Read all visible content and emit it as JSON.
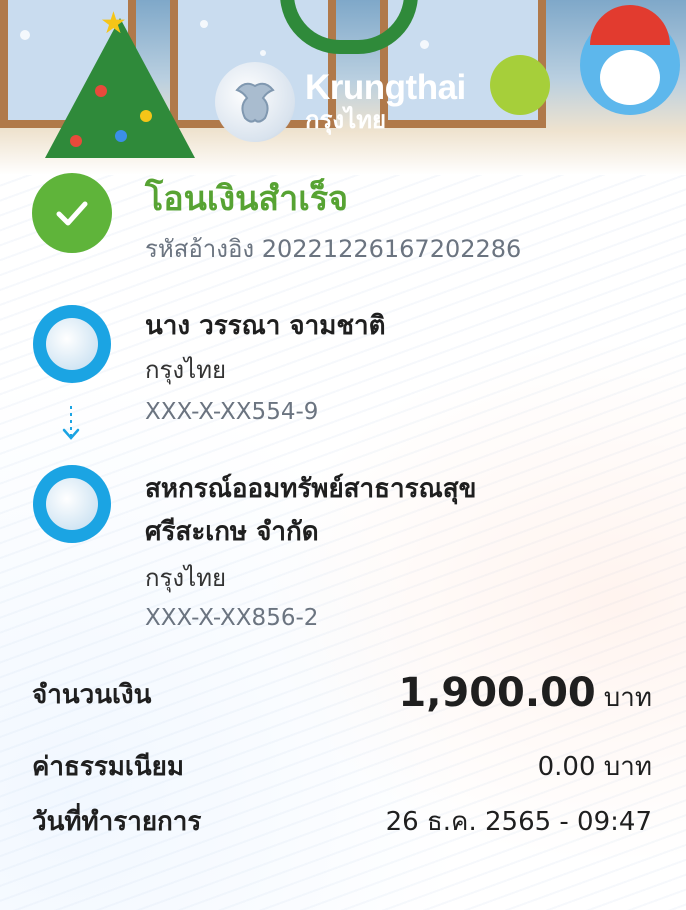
{
  "header": {
    "brand_en": "Krungthai",
    "brand_th": "กรุงไทย"
  },
  "status": {
    "title": "โอนเงินสำเร็จ",
    "reference": "รหัสอ้างอิง 20221226167202286",
    "color": "#5fb43a"
  },
  "sender": {
    "name": "นาง วรรณา จามชาติ",
    "bank": "กรุงไทย",
    "account": "XXX-X-XX554-9"
  },
  "receiver": {
    "name_line1": "สหกรณ์ออมทรัพย์สาธารณสุข",
    "name_line2": "ศรีสะเกษ จำกัด",
    "bank": "กรุงไทย",
    "account": "XXX-X-XX856-2"
  },
  "details": {
    "amount_label": "จำนวนเงิน",
    "amount_value": "1,900.00",
    "amount_unit": "บาท",
    "fee_label": "ค่าธรรมเนียม",
    "fee_value": "0.00 บาท",
    "date_label": "วันที่ทำรายการ",
    "date_value": "26 ธ.ค. 2565 - 09:47"
  },
  "colors": {
    "bank_blue": "#1ba4e3",
    "success_green": "#57a333"
  }
}
